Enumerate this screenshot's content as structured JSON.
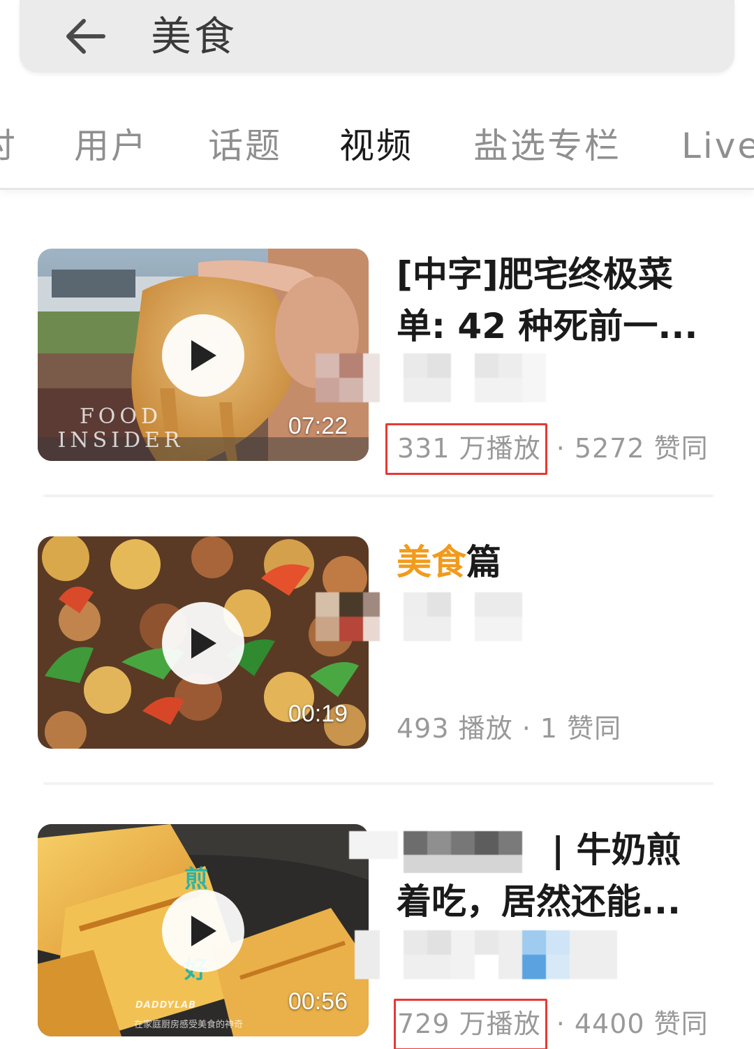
{
  "search": {
    "query": "美食"
  },
  "tabs": [
    {
      "label": "讨"
    },
    {
      "label": "用户"
    },
    {
      "label": "话题"
    },
    {
      "label": "视频",
      "active": true
    },
    {
      "label": "盐选专栏"
    },
    {
      "label": "Live"
    }
  ],
  "videos": [
    {
      "title": "[中字]肥宅终极菜单: 42 种死前一...",
      "duration": "07:22",
      "watermark": "FOOD\nINSIDER",
      "plays": "331 万播放",
      "separator": " · ",
      "likes": "5272 赞同",
      "plays_highlighted": true
    },
    {
      "title_highlight": "美食",
      "title_rest": "篇",
      "duration": "00:19",
      "plays": "493 播放",
      "separator": " · ",
      "likes": "1 赞同",
      "plays_highlighted": false
    },
    {
      "title_line1": "| 牛奶煎",
      "title_line2": "着吃，居然还能...",
      "duration": "00:56",
      "watermark": "DADDYLAB",
      "subtitle": "在家庭厨房感受美食的神奇",
      "plays": "729 万播放",
      "separator": " · ",
      "likes": "4400 赞同",
      "plays_highlighted": true
    }
  ],
  "colors": {
    "accent_highlight": "#f19b1d",
    "annotation_box": "#e53935",
    "muted_text": "#999999"
  }
}
